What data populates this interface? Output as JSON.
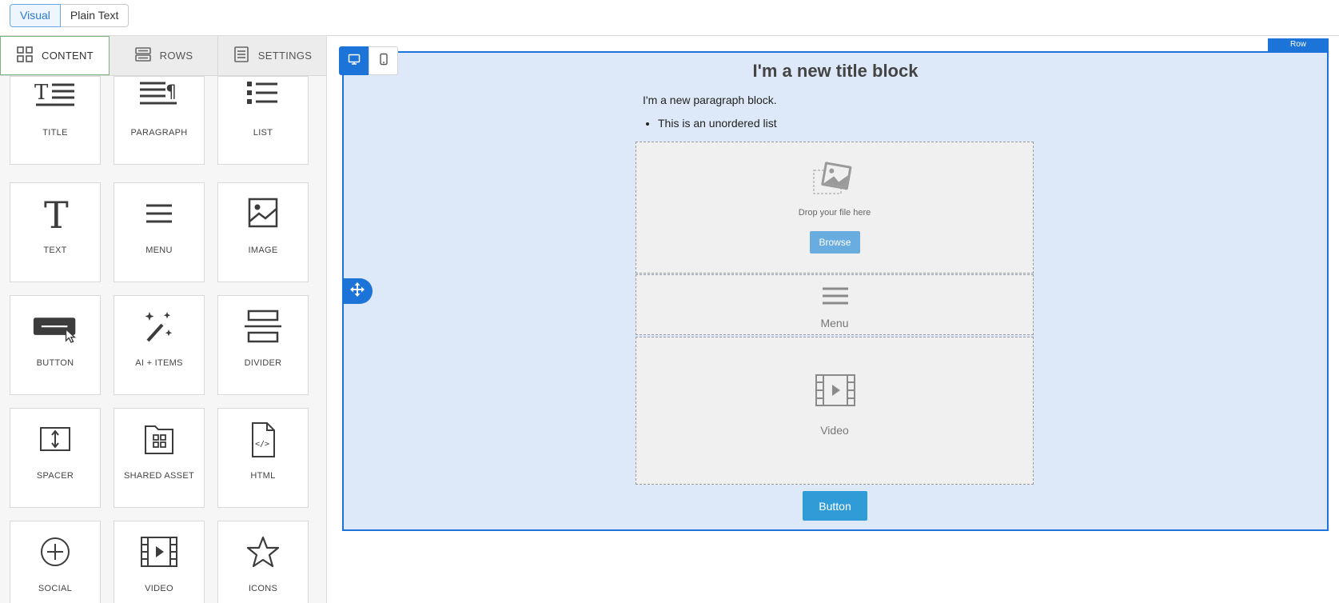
{
  "mode_toggle": {
    "visual": "Visual",
    "plain_text": "Plain Text"
  },
  "sidebar": {
    "tabs": [
      {
        "label": "CONTENT",
        "icon": "grid-icon"
      },
      {
        "label": "ROWS",
        "icon": "rows-icon"
      },
      {
        "label": "SETTINGS",
        "icon": "settings-doc-icon"
      }
    ],
    "blocks": [
      {
        "label": "TITLE",
        "icon": "title-icon"
      },
      {
        "label": "PARAGRAPH",
        "icon": "paragraph-icon"
      },
      {
        "label": "LIST",
        "icon": "list-icon"
      },
      {
        "label": "TEXT",
        "icon": "text-icon"
      },
      {
        "label": "MENU",
        "icon": "menu-icon"
      },
      {
        "label": "IMAGE",
        "icon": "image-icon"
      },
      {
        "label": "BUTTON",
        "icon": "button-icon"
      },
      {
        "label": "AI + ITEMS",
        "icon": "magic-wand-icon"
      },
      {
        "label": "DIVIDER",
        "icon": "divider-icon"
      },
      {
        "label": "SPACER",
        "icon": "spacer-icon"
      },
      {
        "label": "SHARED ASSET",
        "icon": "shared-asset-icon"
      },
      {
        "label": "HTML",
        "icon": "html-file-icon"
      },
      {
        "label": "SOCIAL",
        "icon": "social-icon"
      },
      {
        "label": "VIDEO",
        "icon": "video-icon"
      },
      {
        "label": "ICONS",
        "icon": "star-icon"
      }
    ]
  },
  "canvas": {
    "row_tag": "Row",
    "title": "I'm a new title block",
    "paragraph": "I'm a new paragraph block.",
    "list_items": [
      "This is an unordered list"
    ],
    "image_block": {
      "drop_text": "Drop your file here",
      "browse_label": "Browse"
    },
    "menu_block": {
      "label": "Menu"
    },
    "video_block": {
      "label": "Video"
    },
    "button_label": "Button"
  },
  "colors": {
    "accent": "#1c73d8",
    "row_bg": "#dde9f8",
    "button": "#2f9cd8",
    "browse": "#68ace0"
  }
}
